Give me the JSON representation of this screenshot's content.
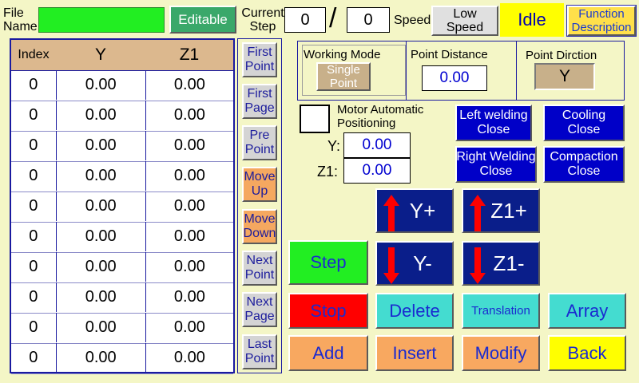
{
  "header": {
    "file_name_label": "File\nName",
    "editable_label": "Editable",
    "current_step_label": "Current\nStep",
    "current_step_value": "0",
    "total_step_value": "0",
    "slash": "/",
    "speed_label": "Speed",
    "speed_value": "Low\nSpeed",
    "status": "Idle",
    "function_description_label": "Function\nDescription"
  },
  "table": {
    "columns": [
      "Index",
      "Y",
      "Z1"
    ],
    "rows": [
      [
        "0",
        "0.00",
        "0.00"
      ],
      [
        "0",
        "0.00",
        "0.00"
      ],
      [
        "0",
        "0.00",
        "0.00"
      ],
      [
        "0",
        "0.00",
        "0.00"
      ],
      [
        "0",
        "0.00",
        "0.00"
      ],
      [
        "0",
        "0.00",
        "0.00"
      ],
      [
        "0",
        "0.00",
        "0.00"
      ],
      [
        "0",
        "0.00",
        "0.00"
      ],
      [
        "0",
        "0.00",
        "0.00"
      ],
      [
        "0",
        "0.00",
        "0.00"
      ]
    ]
  },
  "nav": {
    "first_point": "First\nPoint",
    "first_page": "First\nPage",
    "pre_point": "Pre\nPoint",
    "move_up": "Move\nUp",
    "move_down": "Move\nDown",
    "next_point": "Next\nPoint",
    "next_page": "Next\nPage",
    "last_point": "Last\nPoint"
  },
  "mode_panel": {
    "working_mode_label": "Working Mode",
    "working_mode_value": "Single\nPoint",
    "point_distance_label": "Point Distance",
    "point_distance_value": "0.00",
    "point_direction_label": "Point Dirction",
    "point_direction_value": "Y"
  },
  "motor": {
    "auto_positioning_label": "Motor Automatic\nPositioning",
    "y_label": "Y:",
    "y_value": "0.00",
    "z1_label": "Z1:",
    "z1_value": "0.00"
  },
  "toggles": {
    "left_welding": "Left welding\nClose",
    "cooling": "Cooling\nClose",
    "right_welding": "Right Welding\nClose",
    "compaction": "Compaction\nClose"
  },
  "jog": {
    "y_plus": "Y+",
    "z1_plus": "Z1+",
    "y_minus": "Y-",
    "z1_minus": "Z1-"
  },
  "actions": {
    "step": "Step",
    "stop": "Stop",
    "delete": "Delete",
    "translation": "Translation",
    "array": "Array",
    "add": "Add",
    "insert": "Insert",
    "modify": "Modify",
    "back": "Back"
  },
  "colors": {
    "background": "#f4f6c6",
    "green": "#22ee22",
    "red": "#ff0000",
    "teal": "#44dcd0",
    "orange": "#f8a860",
    "yellow": "#ffff00",
    "blue": "#0000c8",
    "navy": "#0a1e8a"
  }
}
